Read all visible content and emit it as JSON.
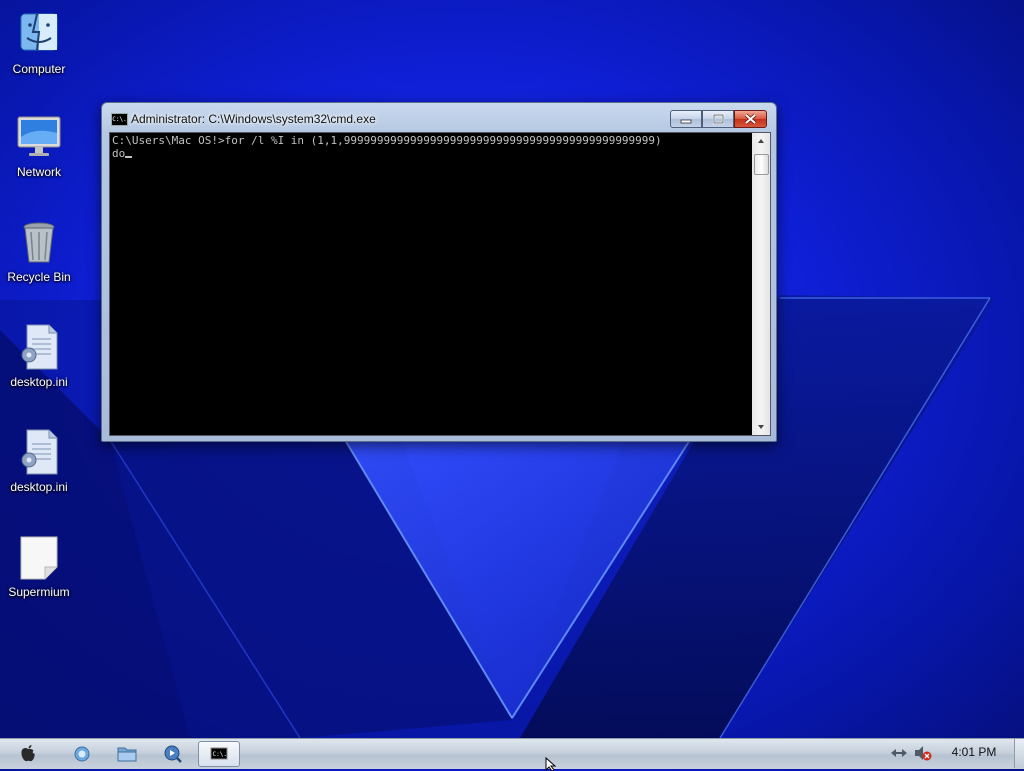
{
  "desktop": {
    "icons": [
      {
        "label": "Computer",
        "icon": "finder-icon"
      },
      {
        "label": "Network",
        "icon": "monitor-icon"
      },
      {
        "label": "Recycle Bin",
        "icon": "trash-can-icon"
      },
      {
        "label": "desktop.ini",
        "icon": "settings-file-icon"
      },
      {
        "label": "desktop.ini",
        "icon": "settings-file-icon"
      },
      {
        "label": "Supermium",
        "icon": "blank-document-icon"
      }
    ]
  },
  "cmd_window": {
    "title": "Administrator: C:\\Windows\\system32\\cmd.exe",
    "title_icon_text": "C:\\.",
    "console_lines": [
      "C:\\Users\\Mac OS!>for /l %I in (1,1,99999999999999999999999999999999999999999999999)",
      "do"
    ],
    "buttons": [
      "minimize",
      "maximize",
      "close"
    ]
  },
  "taskbar": {
    "items": [
      {
        "name": "apple-menu-icon"
      },
      {
        "name": "browser-icon"
      },
      {
        "name": "folder-icon"
      },
      {
        "name": "media-player-icon"
      },
      {
        "name": "cmd-taskbar-icon",
        "text": "C:\\.",
        "active": true
      }
    ],
    "tray": {
      "network_icon": "network-icon",
      "volume_icon": "volume-muted-icon"
    },
    "clock": "4:01 PM"
  },
  "colors": {
    "wallpaper": "#1428d8",
    "console_bg": "#000000",
    "console_text": "#c0c0c0",
    "close_button": "#c9371e"
  }
}
